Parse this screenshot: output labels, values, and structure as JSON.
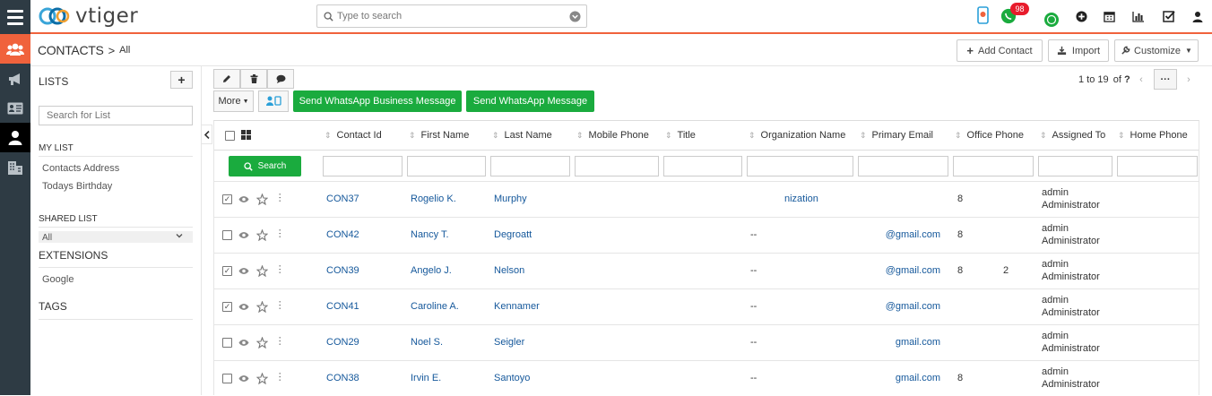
{
  "app": {
    "name": "vtiger"
  },
  "search": {
    "placeholder": "Type to search"
  },
  "topbar": {
    "whatsapp_badge": "98"
  },
  "breadcrumb": {
    "module": "CONTACTS",
    "separator": ">",
    "view": "All"
  },
  "header_buttons": {
    "add_contact": "Add Contact",
    "import": "Import",
    "customize": "Customize"
  },
  "lists_panel": {
    "title": "LISTS",
    "add": "+",
    "search_placeholder": "Search for List",
    "my_list_title": "MY LIST",
    "my_list_items": [
      "Contacts Address",
      "Todays Birthday"
    ],
    "shared_list_title": "SHARED LIST",
    "shared_list_selected": "All",
    "extensions_title": "EXTENSIONS",
    "extensions_items": [
      "Google"
    ],
    "tags_title": "TAGS"
  },
  "toolbar": {
    "more": "More",
    "whatsapp_business": "Send WhatsApp Business Message",
    "whatsapp": "Send WhatsApp Message"
  },
  "pagination": {
    "range": "1 to 19",
    "of": "of",
    "total": "?",
    "more": "···"
  },
  "table": {
    "search_button": "Search",
    "columns": [
      "Contact Id",
      "First Name",
      "Last Name",
      "Mobile Phone",
      "Title",
      "Organization Name",
      "Primary Email",
      "Office Phone",
      "Assigned To",
      "Home Phone"
    ],
    "rows": [
      {
        "checked": true,
        "contact_id": "CON37",
        "first_name": "Rogelio K.",
        "last_name": "Murphy",
        "org_dash": "",
        "org_name": "nization",
        "email": "",
        "office_phone": "8",
        "office_phone2": "",
        "assigned_1": "admin",
        "assigned_2": "Administrator"
      },
      {
        "checked": false,
        "contact_id": "CON42",
        "first_name": "Nancy T.",
        "last_name": "Degroatt",
        "org_dash": "--",
        "org_name": "",
        "email": "@gmail.com",
        "office_phone": "8",
        "office_phone2": "",
        "assigned_1": "admin",
        "assigned_2": "Administrator"
      },
      {
        "checked": true,
        "contact_id": "CON39",
        "first_name": "Angelo J.",
        "last_name": "Nelson",
        "org_dash": "--",
        "org_name": "",
        "email": "@gmail.com",
        "office_phone": "8",
        "office_phone2": "2",
        "assigned_1": "admin",
        "assigned_2": "Administrator"
      },
      {
        "checked": true,
        "contact_id": "CON41",
        "first_name": "Caroline A.",
        "last_name": "Kennamer",
        "org_dash": "--",
        "org_name": "",
        "email": "@gmail.com",
        "office_phone": "",
        "office_phone2": "",
        "assigned_1": "admin",
        "assigned_2": "Administrator"
      },
      {
        "checked": false,
        "contact_id": "CON29",
        "first_name": "Noel S.",
        "last_name": "Seigler",
        "org_dash": "--",
        "org_name": "",
        "email": "gmail.com",
        "office_phone": "",
        "office_phone2": "",
        "assigned_1": "admin",
        "assigned_2": "Administrator"
      },
      {
        "checked": false,
        "contact_id": "CON38",
        "first_name": "Irvin E.",
        "last_name": "Santoyo",
        "org_dash": "--",
        "org_name": "",
        "email": "gmail.com",
        "office_phone": "8",
        "office_phone2": "",
        "assigned_1": "admin",
        "assigned_2": "Administrator"
      }
    ]
  },
  "colors": {
    "accent": "#f0623c",
    "rail": "#2e3b44",
    "green": "#1aab3e",
    "link": "#15589b"
  }
}
